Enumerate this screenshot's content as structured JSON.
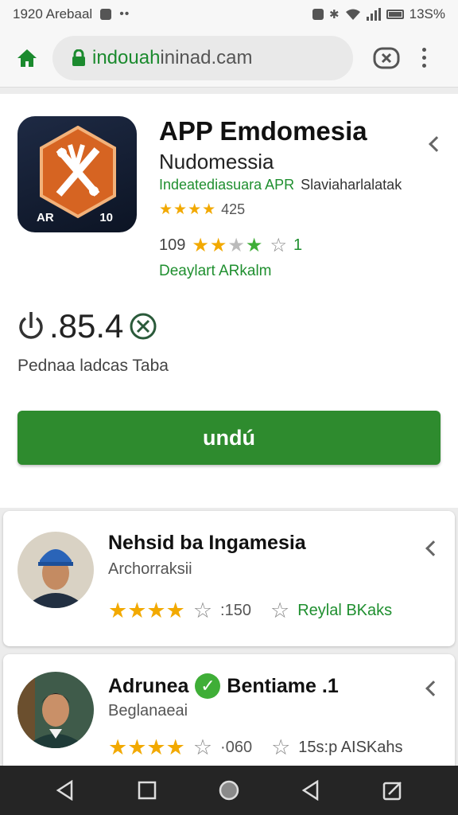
{
  "status_bar": {
    "time_text": "1920 Arebaal",
    "battery_text": "13S%"
  },
  "browser": {
    "url_prefix": "indouah",
    "url_rest": "ininad.cam"
  },
  "app": {
    "title": "APP Emdomesia",
    "subtitle": "Nudomessia",
    "developer": "Indeatediasuara APR",
    "developer_extra": "Slaviaharlalatak",
    "rating_stars": "★★★★",
    "rating_count": "425",
    "rating2_label": "109",
    "rating2_extra": "1",
    "install_note": "Deaylart ARkalm",
    "icon_label_left": "AR",
    "icon_label_right": "10",
    "price": ".85.4",
    "price_sub": "Pednaa ladcas Taba",
    "button_label": "undú"
  },
  "reviews": [
    {
      "name": "Nehsid ba Ingamesia",
      "subtitle": "Archorraksii",
      "stars": "★★★★",
      "count": ":150",
      "note": "Reylal BKaks"
    },
    {
      "name": "Adrunea",
      "name_extra": "Bentiame .1",
      "subtitle": "Beglanaeai",
      "stars": "★★★★",
      "count": "·060",
      "note": "15s:p AISKahs"
    }
  ],
  "colors": {
    "accent_green": "#2e8b2e",
    "star_gold": "#f2a900",
    "link_green": "#1f8f2f"
  }
}
